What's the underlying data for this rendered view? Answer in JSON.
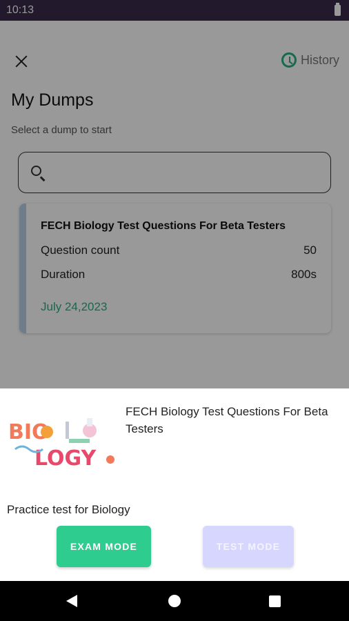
{
  "status": {
    "time": "10:13"
  },
  "header": {
    "history_label": "History"
  },
  "page": {
    "title": "My Dumps",
    "subtitle": "Select a dump to start"
  },
  "search": {
    "placeholder": ""
  },
  "dump_card": {
    "title": "FECH Biology Test Questions For Beta Testers",
    "rows": [
      {
        "label": "Question count",
        "value": "50"
      },
      {
        "label": "Duration",
        "value": "800s"
      }
    ],
    "date": "July 24,2023"
  },
  "sheet": {
    "thumbnail": {
      "word_top": "BIO",
      "word_bottom": "LOGY"
    },
    "title": "FECH Biology Test Questions For Beta Testers",
    "description": "Practice test for Biology",
    "exam_mode_label": "EXAM MODE",
    "test_mode_label": "TEST MODE"
  },
  "colors": {
    "accent_green": "#27b083",
    "exam_button": "#2ecc8f",
    "test_button_disabled": "#d6d6ff",
    "status_bar": "#3a2a4a"
  }
}
